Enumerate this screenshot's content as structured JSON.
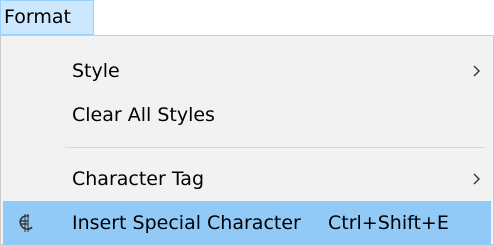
{
  "menubar": {
    "format_label": "Format"
  },
  "menu": {
    "items": [
      {
        "label": "Style",
        "has_submenu": true
      },
      {
        "label": "Clear All Styles",
        "has_submenu": false
      },
      {
        "label": "Character Tag",
        "has_submenu": true
      },
      {
        "label": "Insert Special Character",
        "shortcut": "Ctrl+Shift+E",
        "icon": "special-character-icon",
        "highlighted": true
      }
    ]
  },
  "colors": {
    "menubar_active_bg": "#cce8ff",
    "menu_bg": "#f2f2f2",
    "highlight_bg": "#91c9f7"
  }
}
